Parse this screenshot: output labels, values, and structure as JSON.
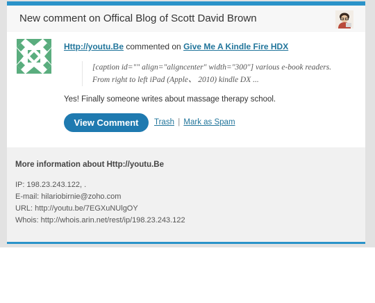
{
  "colors": {
    "accent": "#2a93c9",
    "button": "#1f7ab0",
    "link": "#21759b",
    "identicon": "#5aad7e"
  },
  "header": {
    "title": "New comment on Offical Blog of Scott David Brown",
    "avatar_icon": "user-avatar-icon"
  },
  "comment": {
    "author": "Http://youtu.Be",
    "verb": "commented on",
    "post_title": "Give Me A Kindle Fire HDX",
    "quote_lines": [
      "[caption id=\"\" align=\"aligncenter\" width=\"300\"] various e-book readers.",
      "From right to left iPad (Apple、 2010) kindle DX ..."
    ],
    "text": "Yes! Finally someone writes about massage therapy school.",
    "avatar_icon": "identicon-icon"
  },
  "actions": {
    "view_label": "View Comment",
    "trash_label": "Trash",
    "separator": "|",
    "spam_label": "Mark as Spam"
  },
  "info": {
    "heading": "More information about Http://youtu.Be",
    "ip": "IP: 198.23.243.122, .",
    "email": "E-mail: hilariobirnie@zoho.com",
    "url": "URL: http://youtu.be/7EGXuNUlgOY",
    "whois": "Whois: http://whois.arin.net/rest/ip/198.23.243.122"
  }
}
